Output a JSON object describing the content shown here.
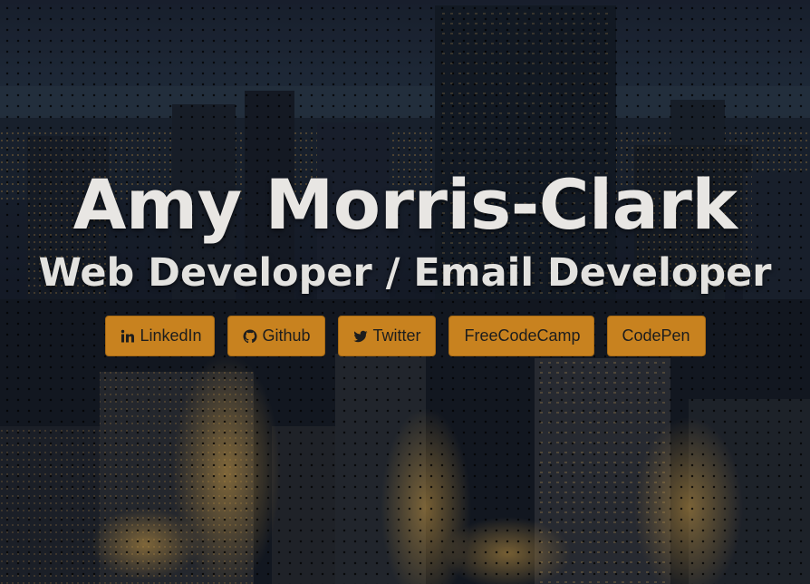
{
  "hero": {
    "name": "Amy Morris-Clark",
    "role": "Web Developer / Email Developer"
  },
  "links": [
    {
      "label": "LinkedIn",
      "icon": "linkedin-icon"
    },
    {
      "label": "Github",
      "icon": "github-icon"
    },
    {
      "label": "Twitter",
      "icon": "twitter-icon"
    },
    {
      "label": "FreeCodeCamp",
      "icon": ""
    },
    {
      "label": "CodePen",
      "icon": ""
    }
  ],
  "colors": {
    "button_bg": "#c8821f",
    "button_text": "#1d1d1d",
    "heading_text": "#e8e6e3",
    "background": "#121722"
  }
}
